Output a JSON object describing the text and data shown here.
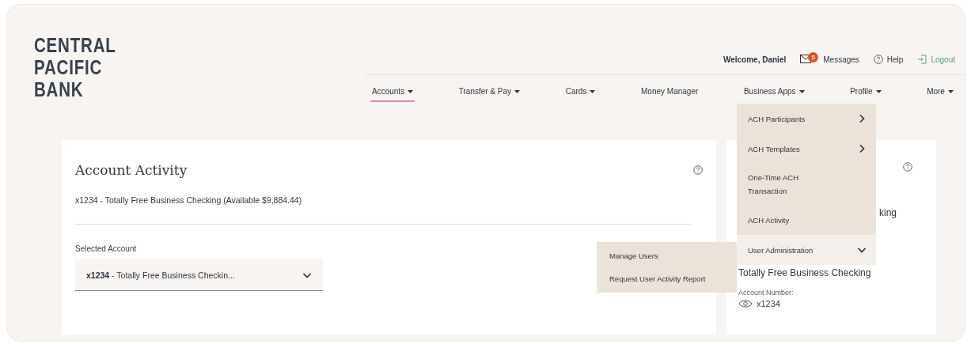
{
  "logo": {
    "lines": [
      "CENTRAL",
      "PACIFIC",
      "BANK"
    ]
  },
  "utility_nav": {
    "welcome": "Welcome, Daniel",
    "messages": {
      "label": "Messages",
      "badge": "5"
    },
    "help": "Help",
    "logout": "Logout"
  },
  "nav": [
    {
      "label": "Accounts",
      "dropdown": true,
      "selected": true
    },
    {
      "label": "Transfer & Pay",
      "dropdown": true,
      "selected": false
    },
    {
      "label": "Cards",
      "dropdown": true,
      "selected": false
    },
    {
      "label": "Money Manager",
      "dropdown": false,
      "selected": false
    },
    {
      "label": "Business Apps",
      "dropdown": true,
      "selected": false
    },
    {
      "label": "Profile",
      "dropdown": true,
      "selected": false
    },
    {
      "label": "More",
      "dropdown": true,
      "selected": false
    }
  ],
  "business_apps_menu": {
    "items": [
      {
        "label": "ACH Participants",
        "kind": "submenu",
        "expanded": false
      },
      {
        "label": "ACH Templates",
        "kind": "submenu",
        "expanded": false
      },
      {
        "label": "One-Time ACH Transaction",
        "kind": "link",
        "expanded": false
      },
      {
        "label": "ACH Activity",
        "kind": "link",
        "expanded": false
      },
      {
        "label": "User Administration",
        "kind": "submenu",
        "expanded": true
      }
    ],
    "submenu": [
      "Manage Users",
      "Request User Activity Report"
    ]
  },
  "account_activity": {
    "title": "Account Activity",
    "summary": "x1234 - Totally Free Business Checking (Available $9,884.44)",
    "select_label": "Selected Account",
    "select_value": "**x1234** - Totally Free Business Checkin..."
  },
  "account_summary": {
    "partial_title": "king",
    "account_name": "Totally Free Business Checking",
    "number_label": "Account Number:",
    "number": "x1234"
  }
}
